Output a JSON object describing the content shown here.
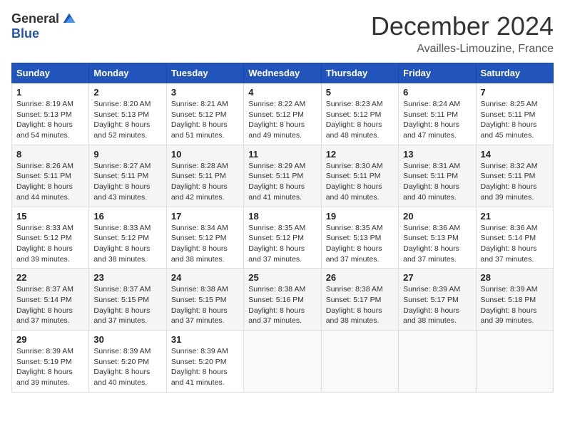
{
  "header": {
    "logo_general": "General",
    "logo_blue": "Blue",
    "month_title": "December 2024",
    "location": "Availles-Limouzine, France"
  },
  "weekdays": [
    "Sunday",
    "Monday",
    "Tuesday",
    "Wednesday",
    "Thursday",
    "Friday",
    "Saturday"
  ],
  "weeks": [
    [
      {
        "day": "1",
        "info": "Sunrise: 8:19 AM\nSunset: 5:13 PM\nDaylight: 8 hours\nand 54 minutes."
      },
      {
        "day": "2",
        "info": "Sunrise: 8:20 AM\nSunset: 5:13 PM\nDaylight: 8 hours\nand 52 minutes."
      },
      {
        "day": "3",
        "info": "Sunrise: 8:21 AM\nSunset: 5:12 PM\nDaylight: 8 hours\nand 51 minutes."
      },
      {
        "day": "4",
        "info": "Sunrise: 8:22 AM\nSunset: 5:12 PM\nDaylight: 8 hours\nand 49 minutes."
      },
      {
        "day": "5",
        "info": "Sunrise: 8:23 AM\nSunset: 5:12 PM\nDaylight: 8 hours\nand 48 minutes."
      },
      {
        "day": "6",
        "info": "Sunrise: 8:24 AM\nSunset: 5:11 PM\nDaylight: 8 hours\nand 47 minutes."
      },
      {
        "day": "7",
        "info": "Sunrise: 8:25 AM\nSunset: 5:11 PM\nDaylight: 8 hours\nand 45 minutes."
      }
    ],
    [
      {
        "day": "8",
        "info": "Sunrise: 8:26 AM\nSunset: 5:11 PM\nDaylight: 8 hours\nand 44 minutes."
      },
      {
        "day": "9",
        "info": "Sunrise: 8:27 AM\nSunset: 5:11 PM\nDaylight: 8 hours\nand 43 minutes."
      },
      {
        "day": "10",
        "info": "Sunrise: 8:28 AM\nSunset: 5:11 PM\nDaylight: 8 hours\nand 42 minutes."
      },
      {
        "day": "11",
        "info": "Sunrise: 8:29 AM\nSunset: 5:11 PM\nDaylight: 8 hours\nand 41 minutes."
      },
      {
        "day": "12",
        "info": "Sunrise: 8:30 AM\nSunset: 5:11 PM\nDaylight: 8 hours\nand 40 minutes."
      },
      {
        "day": "13",
        "info": "Sunrise: 8:31 AM\nSunset: 5:11 PM\nDaylight: 8 hours\nand 40 minutes."
      },
      {
        "day": "14",
        "info": "Sunrise: 8:32 AM\nSunset: 5:11 PM\nDaylight: 8 hours\nand 39 minutes."
      }
    ],
    [
      {
        "day": "15",
        "info": "Sunrise: 8:33 AM\nSunset: 5:12 PM\nDaylight: 8 hours\nand 39 minutes."
      },
      {
        "day": "16",
        "info": "Sunrise: 8:33 AM\nSunset: 5:12 PM\nDaylight: 8 hours\nand 38 minutes."
      },
      {
        "day": "17",
        "info": "Sunrise: 8:34 AM\nSunset: 5:12 PM\nDaylight: 8 hours\nand 38 minutes."
      },
      {
        "day": "18",
        "info": "Sunrise: 8:35 AM\nSunset: 5:12 PM\nDaylight: 8 hours\nand 37 minutes."
      },
      {
        "day": "19",
        "info": "Sunrise: 8:35 AM\nSunset: 5:13 PM\nDaylight: 8 hours\nand 37 minutes."
      },
      {
        "day": "20",
        "info": "Sunrise: 8:36 AM\nSunset: 5:13 PM\nDaylight: 8 hours\nand 37 minutes."
      },
      {
        "day": "21",
        "info": "Sunrise: 8:36 AM\nSunset: 5:14 PM\nDaylight: 8 hours\nand 37 minutes."
      }
    ],
    [
      {
        "day": "22",
        "info": "Sunrise: 8:37 AM\nSunset: 5:14 PM\nDaylight: 8 hours\nand 37 minutes."
      },
      {
        "day": "23",
        "info": "Sunrise: 8:37 AM\nSunset: 5:15 PM\nDaylight: 8 hours\nand 37 minutes."
      },
      {
        "day": "24",
        "info": "Sunrise: 8:38 AM\nSunset: 5:15 PM\nDaylight: 8 hours\nand 37 minutes."
      },
      {
        "day": "25",
        "info": "Sunrise: 8:38 AM\nSunset: 5:16 PM\nDaylight: 8 hours\nand 37 minutes."
      },
      {
        "day": "26",
        "info": "Sunrise: 8:38 AM\nSunset: 5:17 PM\nDaylight: 8 hours\nand 38 minutes."
      },
      {
        "day": "27",
        "info": "Sunrise: 8:39 AM\nSunset: 5:17 PM\nDaylight: 8 hours\nand 38 minutes."
      },
      {
        "day": "28",
        "info": "Sunrise: 8:39 AM\nSunset: 5:18 PM\nDaylight: 8 hours\nand 39 minutes."
      }
    ],
    [
      {
        "day": "29",
        "info": "Sunrise: 8:39 AM\nSunset: 5:19 PM\nDaylight: 8 hours\nand 39 minutes."
      },
      {
        "day": "30",
        "info": "Sunrise: 8:39 AM\nSunset: 5:20 PM\nDaylight: 8 hours\nand 40 minutes."
      },
      {
        "day": "31",
        "info": "Sunrise: 8:39 AM\nSunset: 5:20 PM\nDaylight: 8 hours\nand 41 minutes."
      },
      {
        "day": "",
        "info": ""
      },
      {
        "day": "",
        "info": ""
      },
      {
        "day": "",
        "info": ""
      },
      {
        "day": "",
        "info": ""
      }
    ]
  ]
}
